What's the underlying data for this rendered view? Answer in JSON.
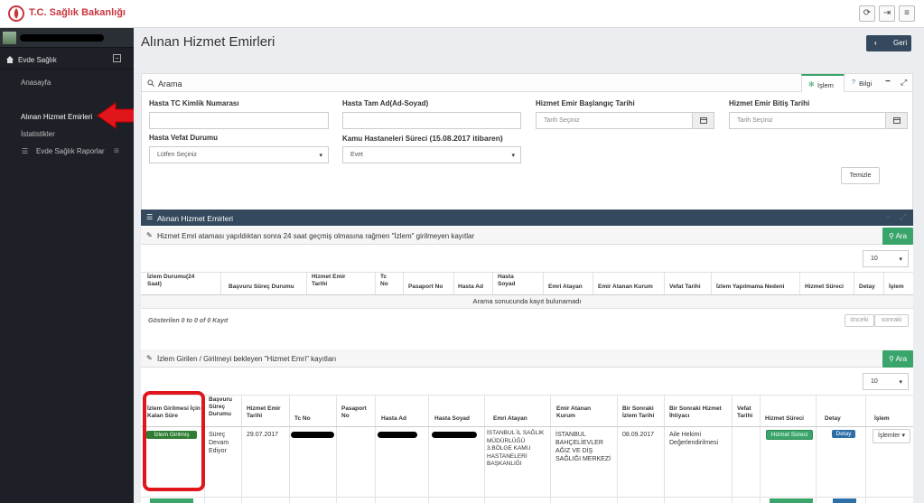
{
  "app": {
    "brand": "T.C. Sağlık Bakanlığı"
  },
  "colors": {
    "brand": "#c9363e",
    "sidebar": "#1d2127",
    "dark_header": "#34495e",
    "green": "#3aa56b",
    "badge_blue": "#2b6ea8",
    "arrow_red": "#e0161c"
  },
  "sidebar": {
    "group": "Evde Sağlık",
    "items": [
      {
        "label": "Anasayfa"
      },
      {
        "label": "Alınan Hizmet Emirleri"
      },
      {
        "label": "İstatistikler"
      },
      {
        "label": "Evde Sağlık Raporlar"
      }
    ]
  },
  "page": {
    "title": "Alınan Hizmet Emirleri",
    "back_label": "Geri"
  },
  "search": {
    "title": "Arama",
    "tab_action": "İşlem",
    "tab_info": "Bilgi",
    "fields": {
      "tc_label": "Hasta TC Kimlik Numarası",
      "name_label": "Hasta Tam Ad(Ad-Soyad)",
      "start_label": "Hizmet Emir Başlangıç Tarihi",
      "start_placeholder": "Tarih Seçiniz",
      "end_label": "Hizmet Emir Bitiş Tarihi",
      "end_placeholder": "Tarih Seçiniz",
      "death_label": "Hasta Vefat Durumu",
      "death_value": "Lütfen Seçiniz",
      "kamu_label": "Kamu Hastaneleri Süreci",
      "kamu_label_extra": "(15.08.2017 itibaren)",
      "kamu_value": "Evet"
    },
    "clear_label": "Temizle"
  },
  "list_panel": {
    "title": "Alınan Hizmet Emirleri"
  },
  "table1": {
    "title": "Hizmet Emri ataması yapıldıktan sonra 24 saat geçmiş olmasına rağmen \"İzlem\" girilmeyen kayıtlar",
    "search_label": "Ara",
    "page_size": "10",
    "headers": [
      "İzlem Durumu(24 Saat)",
      "Başvuru Süreç Durumu",
      "Hizmet Emir Tarihi",
      "Tc No",
      "Pasaport No",
      "Hasta Ad",
      "Hasta Soyad",
      "Emri Atayan",
      "Emir Atanan Kurum",
      "Vefat Tarihi",
      "İzlem Yapılmama Nedeni",
      "Hizmet Süreci",
      "Detay",
      "İşlem"
    ],
    "empty": "Arama sonucunda kayıt bulunamadı",
    "info": "Gösterilen 0 to 0 of 0 Kayıt",
    "prev": "önceki",
    "next": "sonraki"
  },
  "table2": {
    "title": "İzlem Girilen / Girilmeyi bekleyen \"Hizmet Emri\" kayıtları",
    "search_label": "Ara",
    "page_size": "10",
    "headers": [
      "İzlem Girilmesi İçin Kalan Süre",
      "Başvuru Süreç Durumu",
      "Hizmet Emir Tarihi",
      "Tc No",
      "Pasaport No",
      "Hasta Ad",
      "Hasta Soyad",
      "Emri Atayan",
      "Emir Atanan Kurum",
      "Bir Sonraki İzlem Tarihi",
      "Bir Sonraki Hizmet İhtiyacı",
      "Vefat Tarihi",
      "Hizmet Süreci",
      "Detay",
      "İşlem"
    ],
    "row": {
      "badge": "İzlem Girilmiş",
      "status": "Süreç Devam Ediyor",
      "date": "29.07.2017",
      "assigner": "İSTANBUL İL SAĞLIK MÜDÜRLÜĞÜ 3.BÖLGE KAMU HASTANELERİ BAŞKANLIĞI",
      "institution": "İSTANBUL BAHÇELİEVLER AĞIZ VE DİŞ SAĞLIĞI MERKEZİ",
      "next_date": "08.09.2017",
      "next_need": "Aile Hekimi Değerlendirilmesi",
      "process_btn": "Hizmet Süreci",
      "detail_btn": "Detay",
      "actions": "İşlemler"
    }
  }
}
